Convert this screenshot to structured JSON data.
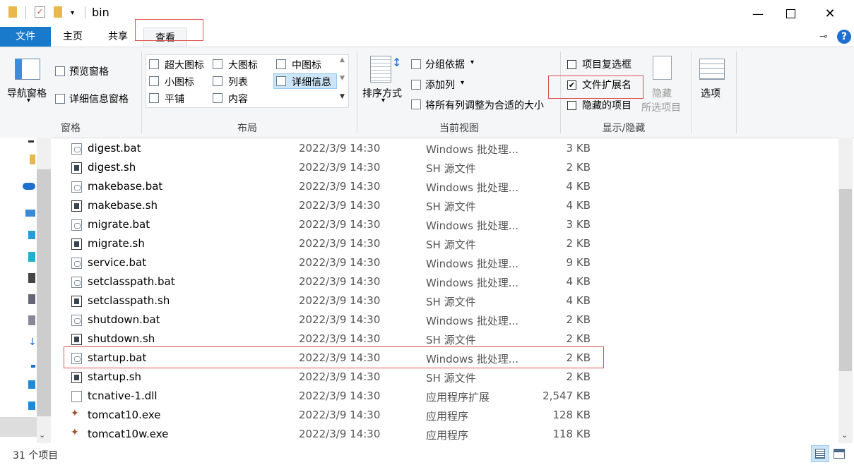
{
  "window": {
    "title": "bin",
    "minimize_icon": "minimize-icon",
    "maximize_icon": "maximize-icon",
    "close_icon": "close-icon"
  },
  "tabs": [
    {
      "label": "文件"
    },
    {
      "label": "主页"
    },
    {
      "label": "共享"
    },
    {
      "label": "查看"
    }
  ],
  "ribbon": {
    "panes": {
      "nav_pane_label": "导航窗格",
      "preview_label": "预览窗格",
      "details_label": "详细信息窗格",
      "group_label": "窗格"
    },
    "layout": {
      "items": [
        "超大图标",
        "大图标",
        "中图标",
        "小图标",
        "列表",
        "详细信息",
        "平铺",
        "内容"
      ],
      "group_label": "布局"
    },
    "current_view": {
      "sort_label": "排序方式",
      "group_by_label": "分组依据",
      "add_column_label": "添加列",
      "fit_columns_label": "将所有列调整为合适的大小",
      "group_label": "当前视图"
    },
    "show_hide": {
      "item_checkbox_label": "项目复选框",
      "file_ext_label": "文件扩展名",
      "hidden_items_label": "隐藏的项目",
      "hide_selected_label_1": "隐藏",
      "hide_selected_label_2": "所选项目",
      "group_label": "显示/隐藏",
      "checkmark": "✔"
    },
    "options_label": "选项"
  },
  "files": [
    {
      "name": "digest.bat",
      "date": "2022/3/9 14:30",
      "type": "Windows 批处理...",
      "size": "3 KB",
      "icon": "bat"
    },
    {
      "name": "digest.sh",
      "date": "2022/3/9 14:30",
      "type": "SH 源文件",
      "size": "2 KB",
      "icon": "sh"
    },
    {
      "name": "makebase.bat",
      "date": "2022/3/9 14:30",
      "type": "Windows 批处理...",
      "size": "4 KB",
      "icon": "bat"
    },
    {
      "name": "makebase.sh",
      "date": "2022/3/9 14:30",
      "type": "SH 源文件",
      "size": "4 KB",
      "icon": "sh"
    },
    {
      "name": "migrate.bat",
      "date": "2022/3/9 14:30",
      "type": "Windows 批处理...",
      "size": "3 KB",
      "icon": "bat"
    },
    {
      "name": "migrate.sh",
      "date": "2022/3/9 14:30",
      "type": "SH 源文件",
      "size": "2 KB",
      "icon": "sh"
    },
    {
      "name": "service.bat",
      "date": "2022/3/9 14:30",
      "type": "Windows 批处理...",
      "size": "9 KB",
      "icon": "bat"
    },
    {
      "name": "setclasspath.bat",
      "date": "2022/3/9 14:30",
      "type": "Windows 批处理...",
      "size": "4 KB",
      "icon": "bat"
    },
    {
      "name": "setclasspath.sh",
      "date": "2022/3/9 14:30",
      "type": "SH 源文件",
      "size": "4 KB",
      "icon": "sh"
    },
    {
      "name": "shutdown.bat",
      "date": "2022/3/9 14:30",
      "type": "Windows 批处理...",
      "size": "2 KB",
      "icon": "bat"
    },
    {
      "name": "shutdown.sh",
      "date": "2022/3/9 14:30",
      "type": "SH 源文件",
      "size": "2 KB",
      "icon": "sh"
    },
    {
      "name": "startup.bat",
      "date": "2022/3/9 14:30",
      "type": "Windows 批处理...",
      "size": "2 KB",
      "icon": "bat"
    },
    {
      "name": "startup.sh",
      "date": "2022/3/9 14:30",
      "type": "SH 源文件",
      "size": "2 KB",
      "icon": "sh"
    },
    {
      "name": "tcnative-1.dll",
      "date": "2022/3/9 14:30",
      "type": "应用程序扩展",
      "size": "2,547 KB",
      "icon": "dll"
    },
    {
      "name": "tomcat10.exe",
      "date": "2022/3/9 14:30",
      "type": "应用程序",
      "size": "128 KB",
      "icon": "exe"
    },
    {
      "name": "tomcat10w.exe",
      "date": "2022/3/9 14:30",
      "type": "应用程序",
      "size": "118 KB",
      "icon": "exe"
    }
  ],
  "status": {
    "item_count": "31 个项目"
  },
  "colors": {
    "file_tab": "#1979ca",
    "highlight_box": "#e05050",
    "ribbon_bg": "#f5f6f7"
  }
}
